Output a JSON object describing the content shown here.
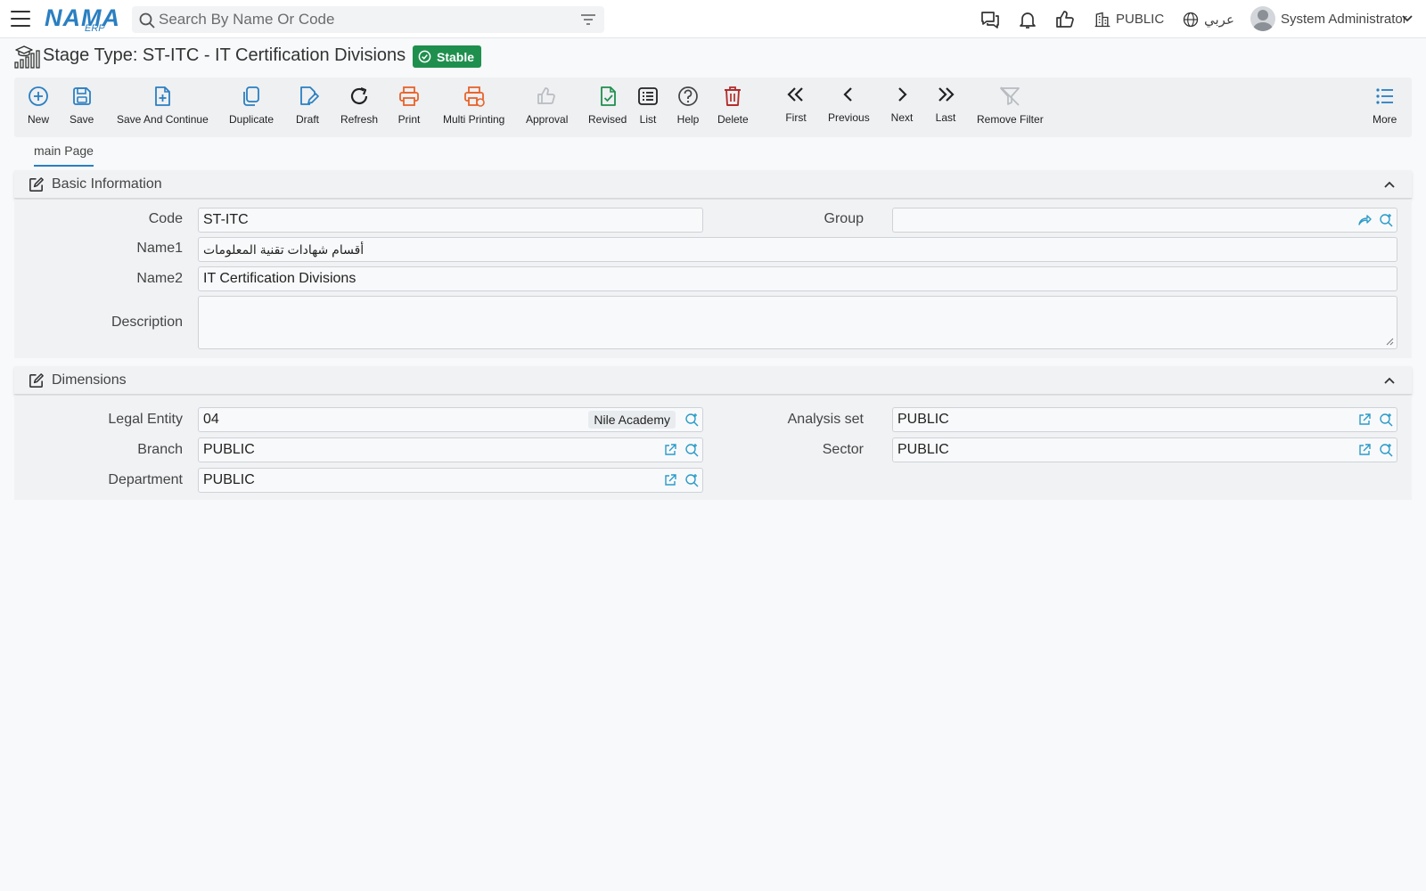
{
  "topbar": {
    "search_placeholder": "Search By Name Or Code",
    "branch": "PUBLIC",
    "language": "عربي",
    "user": "System Administrator",
    "logo_text": "NAMA",
    "logo_sub": "ERP"
  },
  "page": {
    "title": "Stage Type: ST-ITC - IT Certification Divisions",
    "status": "Stable"
  },
  "toolbar": {
    "new": "New",
    "save": "Save",
    "save_continue": "Save And Continue",
    "duplicate": "Duplicate",
    "draft": "Draft",
    "refresh": "Refresh",
    "print": "Print",
    "multi_printing": "Multi Printing",
    "approval": "Approval",
    "revised": "Revised",
    "list": "List",
    "help": "Help",
    "delete": "Delete",
    "first": "First",
    "previous": "Previous",
    "next": "Next",
    "last": "Last",
    "remove_filter": "Remove Filter",
    "more": "More"
  },
  "tabs": {
    "main": "main Page"
  },
  "basic": {
    "title": "Basic Information",
    "code_label": "Code",
    "code_value": "ST-ITC",
    "group_label": "Group",
    "group_value": "",
    "name1_label": "Name1",
    "name1_value": "أقسام شهادات تقنية المعلومات",
    "name2_label": "Name2",
    "name2_value": "IT Certification Divisions",
    "description_label": "Description",
    "description_value": ""
  },
  "dimensions": {
    "title": "Dimensions",
    "legal_entity_label": "Legal Entity",
    "legal_entity_value": "04",
    "legal_entity_tag": "Nile Academy",
    "analysis_set_label": "Analysis set",
    "analysis_set_value": "PUBLIC",
    "branch_label": "Branch",
    "branch_value": "PUBLIC",
    "sector_label": "Sector",
    "sector_value": "PUBLIC",
    "department_label": "Department",
    "department_value": "PUBLIC"
  },
  "colors": {
    "accent": "#2a7fc1",
    "status_green": "#1f8f4e",
    "print_orange": "#e8632a",
    "delete_red": "#b32d2d",
    "revised_green": "#1f8f4e"
  }
}
